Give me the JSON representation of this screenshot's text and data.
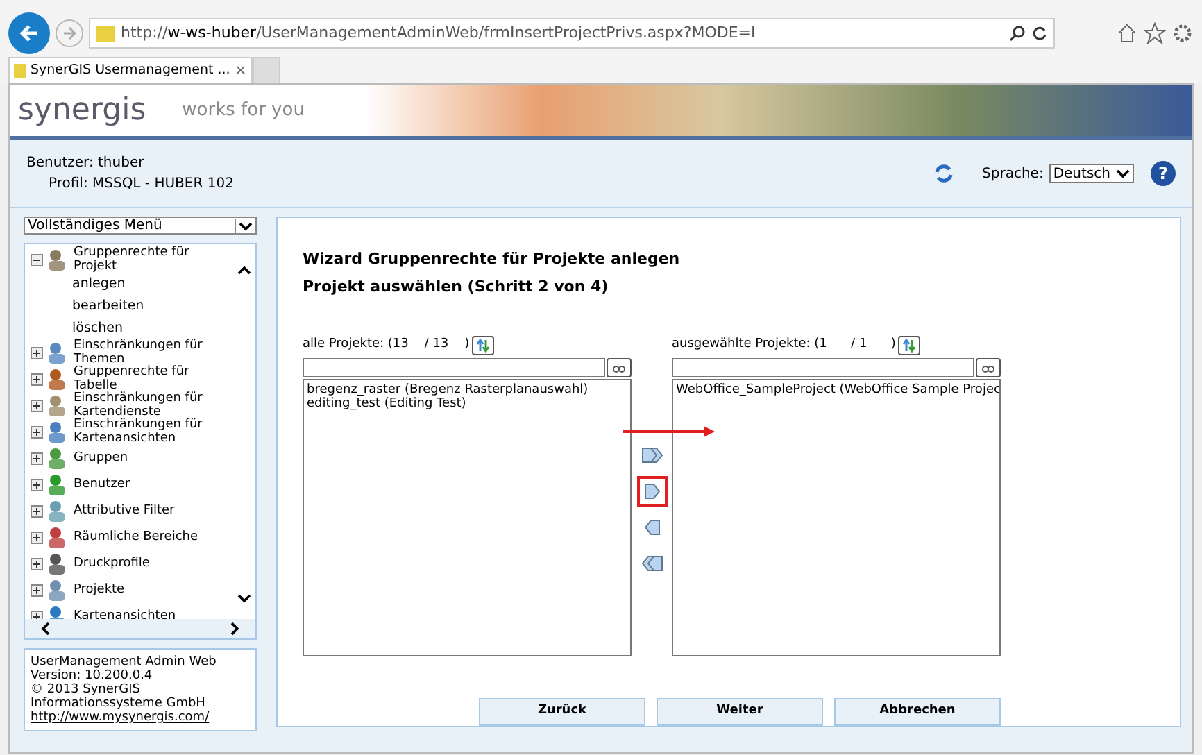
{
  "browser": {
    "url_prefix": "http://",
    "url_host": "w-ws-huber",
    "url_path": "/UserManagementAdminWeb/frmInsertProjectPrivs.aspx?MODE=I",
    "tab_title": "SynerGIS Usermanagement ...",
    "tab_close": "×"
  },
  "banner": {
    "logo": "synergis",
    "slogan": "works for you"
  },
  "info": {
    "user": "Benutzer: thuber",
    "profile": "Profil: MSSQL - HUBER 102",
    "language_label": "Sprache:",
    "language": "Deutsch",
    "help": "?"
  },
  "menu": {
    "select": "Vollständiges Menü",
    "items": [
      {
        "label": "Gruppenrechte für Projekt",
        "expanded": true,
        "children": [
          {
            "label": "anlegen"
          },
          {
            "label": "bearbeiten"
          },
          {
            "label": "löschen"
          }
        ]
      },
      {
        "label": "Einschränkungen für Themen",
        "expanded": false
      },
      {
        "label": "Gruppenrechte für Tabelle",
        "expanded": false
      },
      {
        "label": "Einschränkungen für Kartendienste",
        "expanded": false
      },
      {
        "label": "Einschränkungen für Kartenansichten",
        "expanded": false
      },
      {
        "label": "Gruppen",
        "expanded": false
      },
      {
        "label": "Benutzer",
        "expanded": false
      },
      {
        "label": "Attributive Filter",
        "expanded": false
      },
      {
        "label": "Räumliche Bereiche",
        "expanded": false
      },
      {
        "label": "Druckprofile",
        "expanded": false
      },
      {
        "label": "Projekte",
        "expanded": false
      },
      {
        "label": "Kartenansichten",
        "expanded": false
      }
    ]
  },
  "about": [
    "UserManagement Admin Web",
    "Version: 10.200.0.4",
    "© 2013 SynerGIS",
    "Informationssysteme GmbH"
  ],
  "about_link": "http://www.mysynergis.com/",
  "wizard": {
    "title": "Wizard Gruppenrechte für Projekte anlegen",
    "subtitle": "Projekt auswählen (Schritt 2 von 4)",
    "lists": [
      {
        "label": "alle Projekte: (13    / 13    )",
        "items": [
          "bregenz_raster (Bregenz Rasterplanauswahl)",
          "editing_test (Editing Test)"
        ]
      },
      {
        "label": "ausgewählte Projekte: (1      / 1      )",
        "items": [
          "WebOffice_SampleProject (WebOffice Sample Projec"
        ]
      }
    ],
    "move_buttons": [
      {
        "kind": "all-right",
        "highlighted": false
      },
      {
        "kind": "right",
        "highlighted": true
      },
      {
        "kind": "left",
        "highlighted": false
      },
      {
        "kind": "all-left",
        "highlighted": false
      }
    ],
    "buttons": [
      "Zurück",
      "Weiter",
      "Abbrechen"
    ]
  }
}
